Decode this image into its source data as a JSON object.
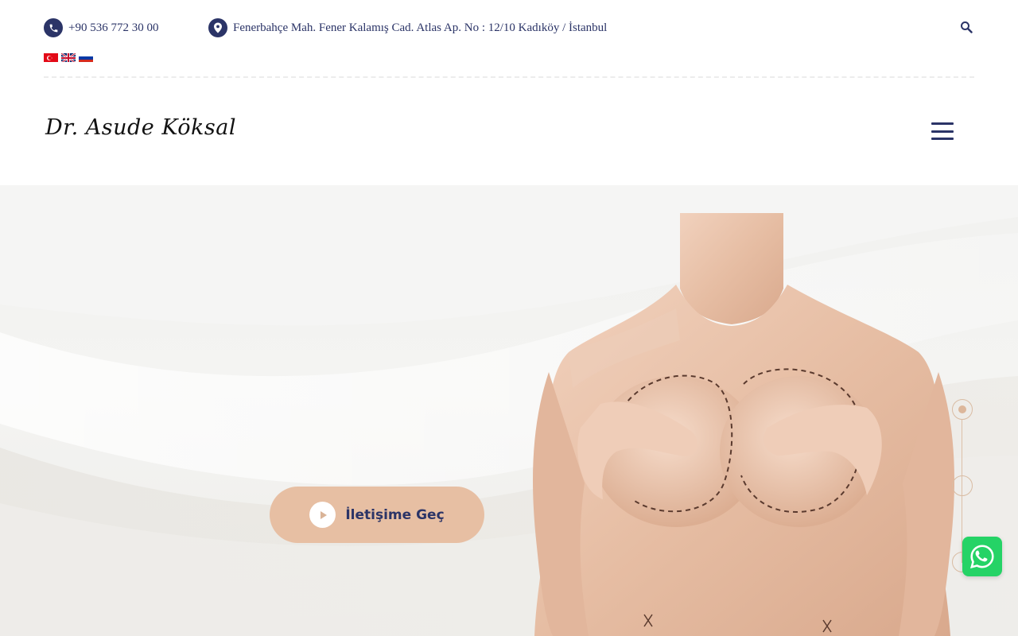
{
  "topbar": {
    "phone": "+90 536 772 30 00",
    "address": "Fenerbahçe Mah. Fener Kalamış Cad. Atlas Ap. No : 12/10 Kadıköy / İstanbul",
    "search_icon": "search-icon",
    "languages": [
      {
        "code": "tr",
        "flag": "turkey-flag-icon"
      },
      {
        "code": "en",
        "flag": "uk-flag-icon"
      },
      {
        "code": "ru",
        "flag": "russia-flag-icon"
      }
    ]
  },
  "header": {
    "logo_text": "Dr. Asude Köksal",
    "menu_icon": "hamburger-menu-icon"
  },
  "hero": {
    "cta_label": "İletişime Geç",
    "cta_icon": "play-icon",
    "slider": {
      "count": 3,
      "active": 1
    }
  },
  "floating": {
    "whatsapp_icon": "whatsapp-icon"
  },
  "colors": {
    "navy": "#2b3467",
    "accent": "#e7bfa3",
    "whatsapp": "#25d366"
  }
}
